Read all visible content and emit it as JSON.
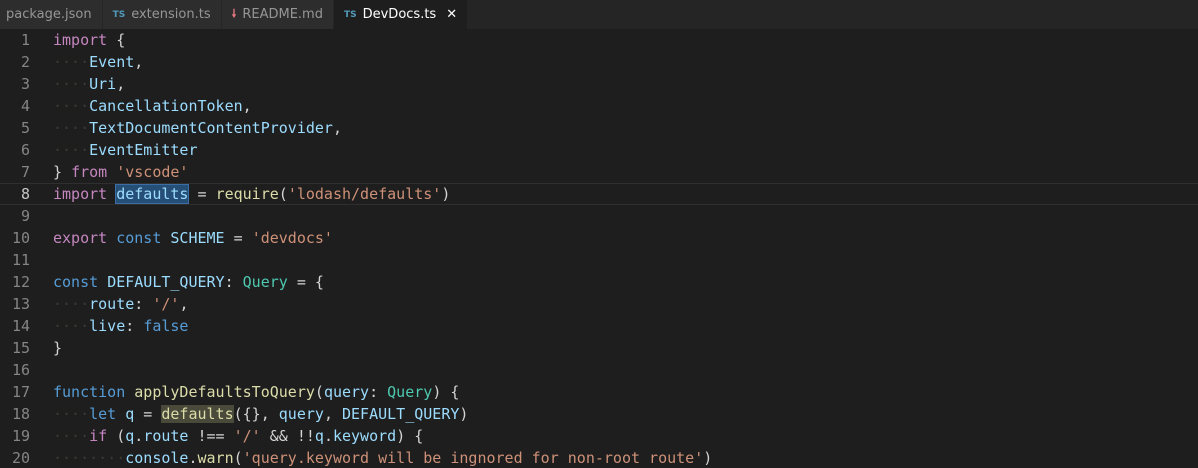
{
  "tabs": [
    {
      "label": "package.json",
      "icon": "json-file-icon",
      "icon_text": "",
      "active": false
    },
    {
      "label": "extension.ts",
      "icon": "typescript-file-icon",
      "icon_text": "TS",
      "active": false
    },
    {
      "label": "README.md",
      "icon": "markdown-file-icon",
      "icon_text": "🠗",
      "active": false
    },
    {
      "label": "DevDocs.ts",
      "icon": "typescript-file-icon",
      "icon_text": "TS",
      "active": true
    }
  ],
  "close_glyph": "✕",
  "editor": {
    "current_line": 8,
    "lines": [
      {
        "n": "1",
        "t": [
          [
            "import",
            "kw"
          ],
          [
            " {",
            "pun"
          ]
        ]
      },
      {
        "n": "2",
        "t": [
          [
            "····",
            "ws"
          ],
          [
            "Event",
            "var"
          ],
          [
            ",",
            "pun"
          ]
        ]
      },
      {
        "n": "3",
        "t": [
          [
            "····",
            "ws"
          ],
          [
            "Uri",
            "var"
          ],
          [
            ",",
            "pun"
          ]
        ]
      },
      {
        "n": "4",
        "t": [
          [
            "····",
            "ws"
          ],
          [
            "CancellationToken",
            "var"
          ],
          [
            ",",
            "pun"
          ]
        ]
      },
      {
        "n": "5",
        "t": [
          [
            "····",
            "ws"
          ],
          [
            "TextDocumentContentProvider",
            "var"
          ],
          [
            ",",
            "pun"
          ]
        ]
      },
      {
        "n": "6",
        "t": [
          [
            "····",
            "ws"
          ],
          [
            "EventEmitter",
            "var"
          ]
        ]
      },
      {
        "n": "7",
        "t": [
          [
            "} ",
            "pun"
          ],
          [
            "from",
            "kw"
          ],
          [
            " ",
            "pun"
          ],
          [
            "'vscode'",
            "str"
          ]
        ]
      },
      {
        "n": "8",
        "t": [
          [
            "import",
            "kw"
          ],
          [
            " ",
            "pun"
          ],
          [
            "defaults",
            "var hl"
          ],
          [
            " = ",
            "pun"
          ],
          [
            "require",
            "fn"
          ],
          [
            "(",
            "pun"
          ],
          [
            "'lodash/defaults'",
            "str"
          ],
          [
            ")",
            "pun"
          ]
        ]
      },
      {
        "n": "9",
        "t": []
      },
      {
        "n": "10",
        "t": [
          [
            "export",
            "kw"
          ],
          [
            " ",
            "pun"
          ],
          [
            "const",
            "sk"
          ],
          [
            " ",
            "pun"
          ],
          [
            "SCHEME",
            "var"
          ],
          [
            " = ",
            "pun"
          ],
          [
            "'devdocs'",
            "str"
          ]
        ]
      },
      {
        "n": "11",
        "t": []
      },
      {
        "n": "12",
        "t": [
          [
            "const",
            "sk"
          ],
          [
            " ",
            "pun"
          ],
          [
            "DEFAULT_QUERY",
            "var"
          ],
          [
            ": ",
            "pun"
          ],
          [
            "Query",
            "ty"
          ],
          [
            " = {",
            "pun"
          ]
        ]
      },
      {
        "n": "13",
        "t": [
          [
            "····",
            "ws"
          ],
          [
            "route",
            "var"
          ],
          [
            ": ",
            "pun"
          ],
          [
            "'/'",
            "str"
          ],
          [
            ",",
            "pun"
          ]
        ]
      },
      {
        "n": "14",
        "t": [
          [
            "····",
            "ws"
          ],
          [
            "live",
            "var"
          ],
          [
            ": ",
            "pun"
          ],
          [
            "false",
            "sk"
          ]
        ]
      },
      {
        "n": "15",
        "t": [
          [
            "}",
            "pun"
          ]
        ]
      },
      {
        "n": "16",
        "t": []
      },
      {
        "n": "17",
        "t": [
          [
            "function",
            "sk"
          ],
          [
            " ",
            "pun"
          ],
          [
            "applyDefaultsToQuery",
            "fn"
          ],
          [
            "(",
            "pun"
          ],
          [
            "query",
            "var"
          ],
          [
            ": ",
            "pun"
          ],
          [
            "Query",
            "ty"
          ],
          [
            ") {",
            "pun"
          ]
        ]
      },
      {
        "n": "18",
        "t": [
          [
            "····",
            "ws"
          ],
          [
            "let",
            "sk"
          ],
          [
            " ",
            "pun"
          ],
          [
            "q",
            "var"
          ],
          [
            " = ",
            "pun"
          ],
          [
            "defaults",
            "fn hl2"
          ],
          [
            "({}, ",
            "pun"
          ],
          [
            "query",
            "var"
          ],
          [
            ", ",
            "pun"
          ],
          [
            "DEFAULT_QUERY",
            "var"
          ],
          [
            ")",
            "pun"
          ]
        ]
      },
      {
        "n": "19",
        "t": [
          [
            "····",
            "ws"
          ],
          [
            "if",
            "kw"
          ],
          [
            " (",
            "pun"
          ],
          [
            "q",
            "var"
          ],
          [
            ".",
            "pun"
          ],
          [
            "route",
            "var"
          ],
          [
            " !== ",
            "pun"
          ],
          [
            "'/'",
            "str"
          ],
          [
            " && !!",
            "pun"
          ],
          [
            "q",
            "var"
          ],
          [
            ".",
            "pun"
          ],
          [
            "keyword",
            "var"
          ],
          [
            ") {",
            "pun"
          ]
        ]
      },
      {
        "n": "20",
        "t": [
          [
            "········",
            "ws"
          ],
          [
            "console",
            "var"
          ],
          [
            ".",
            "pun"
          ],
          [
            "warn",
            "fn"
          ],
          [
            "(",
            "pun"
          ],
          [
            "'query.keyword will be ingnored for non-root route'",
            "str"
          ],
          [
            ")",
            "pun"
          ]
        ]
      }
    ]
  }
}
